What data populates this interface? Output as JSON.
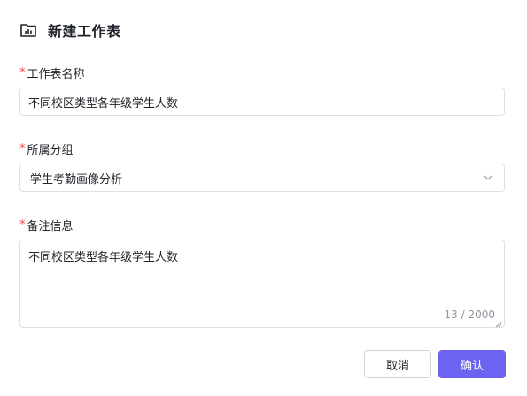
{
  "dialog": {
    "title": "新建工作表",
    "title_icon": "folder-chart-icon"
  },
  "form": {
    "required_mark": "*",
    "name": {
      "label": "工作表名称",
      "value": "不同校区类型各年级学生人数"
    },
    "group": {
      "label": "所属分组",
      "selected": "学生考勤画像分析",
      "icon": "chevron-down-icon"
    },
    "notes": {
      "label": "备注信息",
      "value": "不同校区类型各年级学生人数",
      "counter": "13 / 2000"
    }
  },
  "actions": {
    "cancel_label": "取消",
    "confirm_label": "确认"
  },
  "colors": {
    "accent": "#6c63f0",
    "required": "#f54a45",
    "border": "#dee0e3"
  }
}
